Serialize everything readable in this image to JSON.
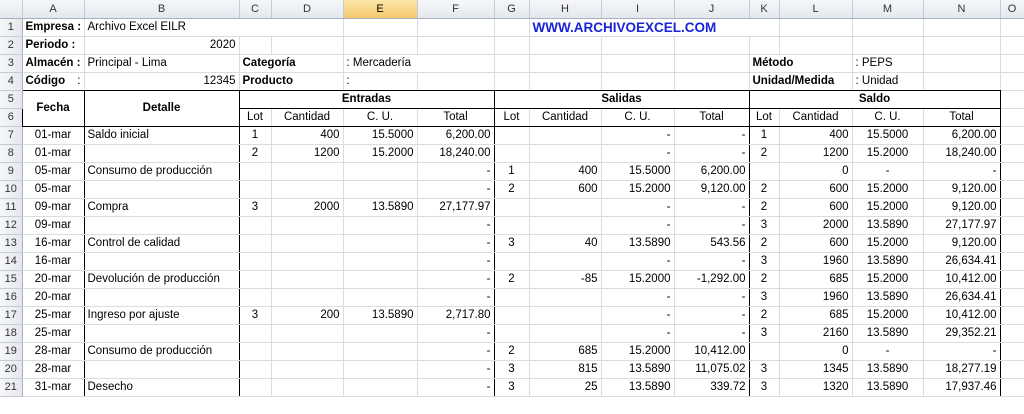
{
  "columns": [
    "A",
    "B",
    "C",
    "D",
    "E",
    "F",
    "G",
    "H",
    "I",
    "J",
    "K",
    "L",
    "M",
    "N",
    "O"
  ],
  "header": {
    "empresa_label": "Empresa :",
    "empresa_value": "Archivo Excel EILR",
    "url": "WWW.ARCHIVOEXCEL.COM",
    "periodo_label": "Periodo  :",
    "periodo_value": "2020",
    "almacen_label": "Almacén :",
    "almacen_value": "Principal - Lima",
    "categoria_label": "Categoría",
    "categoria_value": ": Mercadería",
    "metodo_label": "Método",
    "metodo_value": ":  PEPS",
    "codigo_label": "Código",
    "codigo_colon": ":",
    "codigo_value": "12345",
    "producto_label": "Producto",
    "producto_colon": ":",
    "unidad_label": "Unidad/Medida",
    "unidad_value": ": Unidad"
  },
  "table_headers": {
    "fecha": "Fecha",
    "detalle": "Detalle",
    "entradas": "Entradas",
    "salidas": "Salidas",
    "saldo": "Saldo",
    "lot": "Lot",
    "cantidad": "Cantidad",
    "cu": "C. U.",
    "total": "Total"
  },
  "rows": [
    {
      "n": "7",
      "fecha": "01-mar",
      "detalle": "Saldo inicial",
      "e_lot": "1",
      "e_cant": "400",
      "e_cu": "15.5000",
      "e_total": "6,200.00",
      "s_lot": "",
      "s_cant": "",
      "s_cu": "-",
      "s_total": "-",
      "b_lot": "1",
      "b_cant": "400",
      "b_cu": "15.5000",
      "b_total": "6,200.00"
    },
    {
      "n": "8",
      "fecha": "01-mar",
      "detalle": "",
      "e_lot": "2",
      "e_cant": "1200",
      "e_cu": "15.2000",
      "e_total": "18,240.00",
      "s_lot": "",
      "s_cant": "",
      "s_cu": "-",
      "s_total": "-",
      "b_lot": "2",
      "b_cant": "1200",
      "b_cu": "15.2000",
      "b_total": "18,240.00"
    },
    {
      "n": "9",
      "fecha": "05-mar",
      "detalle": "Consumo de producción",
      "e_lot": "",
      "e_cant": "",
      "e_cu": "",
      "e_total": "-",
      "s_lot": "1",
      "s_cant": "400",
      "s_cu": "15.5000",
      "s_total": "6,200.00",
      "b_lot": "",
      "b_cant": "0",
      "b_cu": "-",
      "b_total": "-"
    },
    {
      "n": "10",
      "fecha": "05-mar",
      "detalle": "",
      "e_lot": "",
      "e_cant": "",
      "e_cu": "",
      "e_total": "-",
      "s_lot": "2",
      "s_cant": "600",
      "s_cu": "15.2000",
      "s_total": "9,120.00",
      "b_lot": "2",
      "b_cant": "600",
      "b_cu": "15.2000",
      "b_total": "9,120.00"
    },
    {
      "n": "11",
      "fecha": "09-mar",
      "detalle": "Compra",
      "e_lot": "3",
      "e_cant": "2000",
      "e_cu": "13.5890",
      "e_total": "27,177.97",
      "s_lot": "",
      "s_cant": "",
      "s_cu": "-",
      "s_total": "-",
      "b_lot": "2",
      "b_cant": "600",
      "b_cu": "15.2000",
      "b_total": "9,120.00"
    },
    {
      "n": "12",
      "fecha": "09-mar",
      "detalle": "",
      "e_lot": "",
      "e_cant": "",
      "e_cu": "",
      "e_total": "-",
      "s_lot": "",
      "s_cant": "",
      "s_cu": "-",
      "s_total": "-",
      "b_lot": "3",
      "b_cant": "2000",
      "b_cu": "13.5890",
      "b_total": "27,177.97"
    },
    {
      "n": "13",
      "fecha": "16-mar",
      "detalle": "Control de calidad",
      "e_lot": "",
      "e_cant": "",
      "e_cu": "",
      "e_total": "-",
      "s_lot": "3",
      "s_cant": "40",
      "s_cu": "13.5890",
      "s_total": "543.56",
      "b_lot": "2",
      "b_cant": "600",
      "b_cu": "15.2000",
      "b_total": "9,120.00"
    },
    {
      "n": "14",
      "fecha": "16-mar",
      "detalle": "",
      "e_lot": "",
      "e_cant": "",
      "e_cu": "",
      "e_total": "-",
      "s_lot": "",
      "s_cant": "",
      "s_cu": "-",
      "s_total": "-",
      "b_lot": "3",
      "b_cant": "1960",
      "b_cu": "13.5890",
      "b_total": "26,634.41"
    },
    {
      "n": "15",
      "fecha": "20-mar",
      "detalle": "Devolución de producción",
      "e_lot": "",
      "e_cant": "",
      "e_cu": "",
      "e_total": "-",
      "s_lot": "2",
      "s_cant": "-85",
      "s_cu": "15.2000",
      "s_total": "-1,292.00",
      "b_lot": "2",
      "b_cant": "685",
      "b_cu": "15.2000",
      "b_total": "10,412.00"
    },
    {
      "n": "16",
      "fecha": "20-mar",
      "detalle": "",
      "e_lot": "",
      "e_cant": "",
      "e_cu": "",
      "e_total": "-",
      "s_lot": "",
      "s_cant": "",
      "s_cu": "-",
      "s_total": "-",
      "b_lot": "3",
      "b_cant": "1960",
      "b_cu": "13.5890",
      "b_total": "26,634.41"
    },
    {
      "n": "17",
      "fecha": "25-mar",
      "detalle": "Ingreso por ajuste",
      "e_lot": "3",
      "e_cant": "200",
      "e_cu": "13.5890",
      "e_total": "2,717.80",
      "s_lot": "",
      "s_cant": "",
      "s_cu": "-",
      "s_total": "-",
      "b_lot": "2",
      "b_cant": "685",
      "b_cu": "15.2000",
      "b_total": "10,412.00"
    },
    {
      "n": "18",
      "fecha": "25-mar",
      "detalle": "",
      "e_lot": "",
      "e_cant": "",
      "e_cu": "",
      "e_total": "-",
      "s_lot": "",
      "s_cant": "",
      "s_cu": "-",
      "s_total": "-",
      "b_lot": "3",
      "b_cant": "2160",
      "b_cu": "13.5890",
      "b_total": "29,352.21"
    },
    {
      "n": "19",
      "fecha": "28-mar",
      "detalle": "Consumo de producción",
      "e_lot": "",
      "e_cant": "",
      "e_cu": "",
      "e_total": "-",
      "s_lot": "2",
      "s_cant": "685",
      "s_cu": "15.2000",
      "s_total": "10,412.00",
      "b_lot": "",
      "b_cant": "0",
      "b_cu": "-",
      "b_total": "-"
    },
    {
      "n": "20",
      "fecha": "28-mar",
      "detalle": "",
      "e_lot": "",
      "e_cant": "",
      "e_cu": "",
      "e_total": "-",
      "s_lot": "3",
      "s_cant": "815",
      "s_cu": "13.5890",
      "s_total": "11,075.02",
      "b_lot": "3",
      "b_cant": "1345",
      "b_cu": "13.5890",
      "b_total": "18,277.19"
    },
    {
      "n": "21",
      "fecha": "31-mar",
      "detalle": "Desecho",
      "e_lot": "",
      "e_cant": "",
      "e_cu": "",
      "e_total": "-",
      "s_lot": "3",
      "s_cant": "25",
      "s_cu": "13.5890",
      "s_total": "339.72",
      "b_lot": "3",
      "b_cant": "1320",
      "b_cu": "13.5890",
      "b_total": "17,937.46"
    }
  ]
}
